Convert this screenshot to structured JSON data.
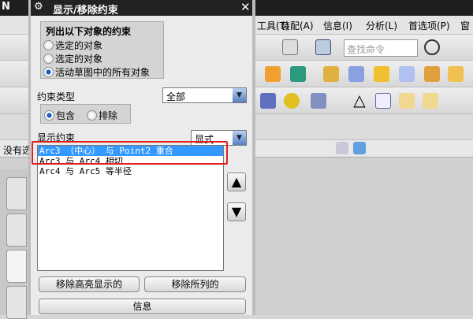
{
  "app": {
    "title_fragment": "N",
    "menus": [
      "工具(T)",
      "装配(A)",
      "信息(I)",
      "分析(L)",
      "首选项(P)",
      "窗口"
    ],
    "search_placeholder": "查找命令",
    "status_text": "没有选"
  },
  "dialog": {
    "title": "显示/移除约束",
    "group_title": "列出以下对象的约束",
    "scope_options": [
      {
        "label": "选定的对象",
        "selected": false
      },
      {
        "label": "选定的对象",
        "selected": false
      },
      {
        "label": "活动草图中的所有对象",
        "selected": true
      }
    ],
    "constraint_type_label": "约束类型",
    "constraint_type_value": "全部",
    "include_label": "包含",
    "exclude_label": "排除",
    "include_selected": true,
    "show_label": "显示约束",
    "show_value": "显式",
    "list": [
      "Arc3 （中心） 与 Point2  重合",
      "Arc3 与 Arc4 相切",
      "Arc4 与 Arc5 等半径"
    ],
    "selected_index": 0,
    "remove_highlighted": "移除高亮显示的",
    "remove_listed": "移除所列的",
    "info": "信息"
  }
}
